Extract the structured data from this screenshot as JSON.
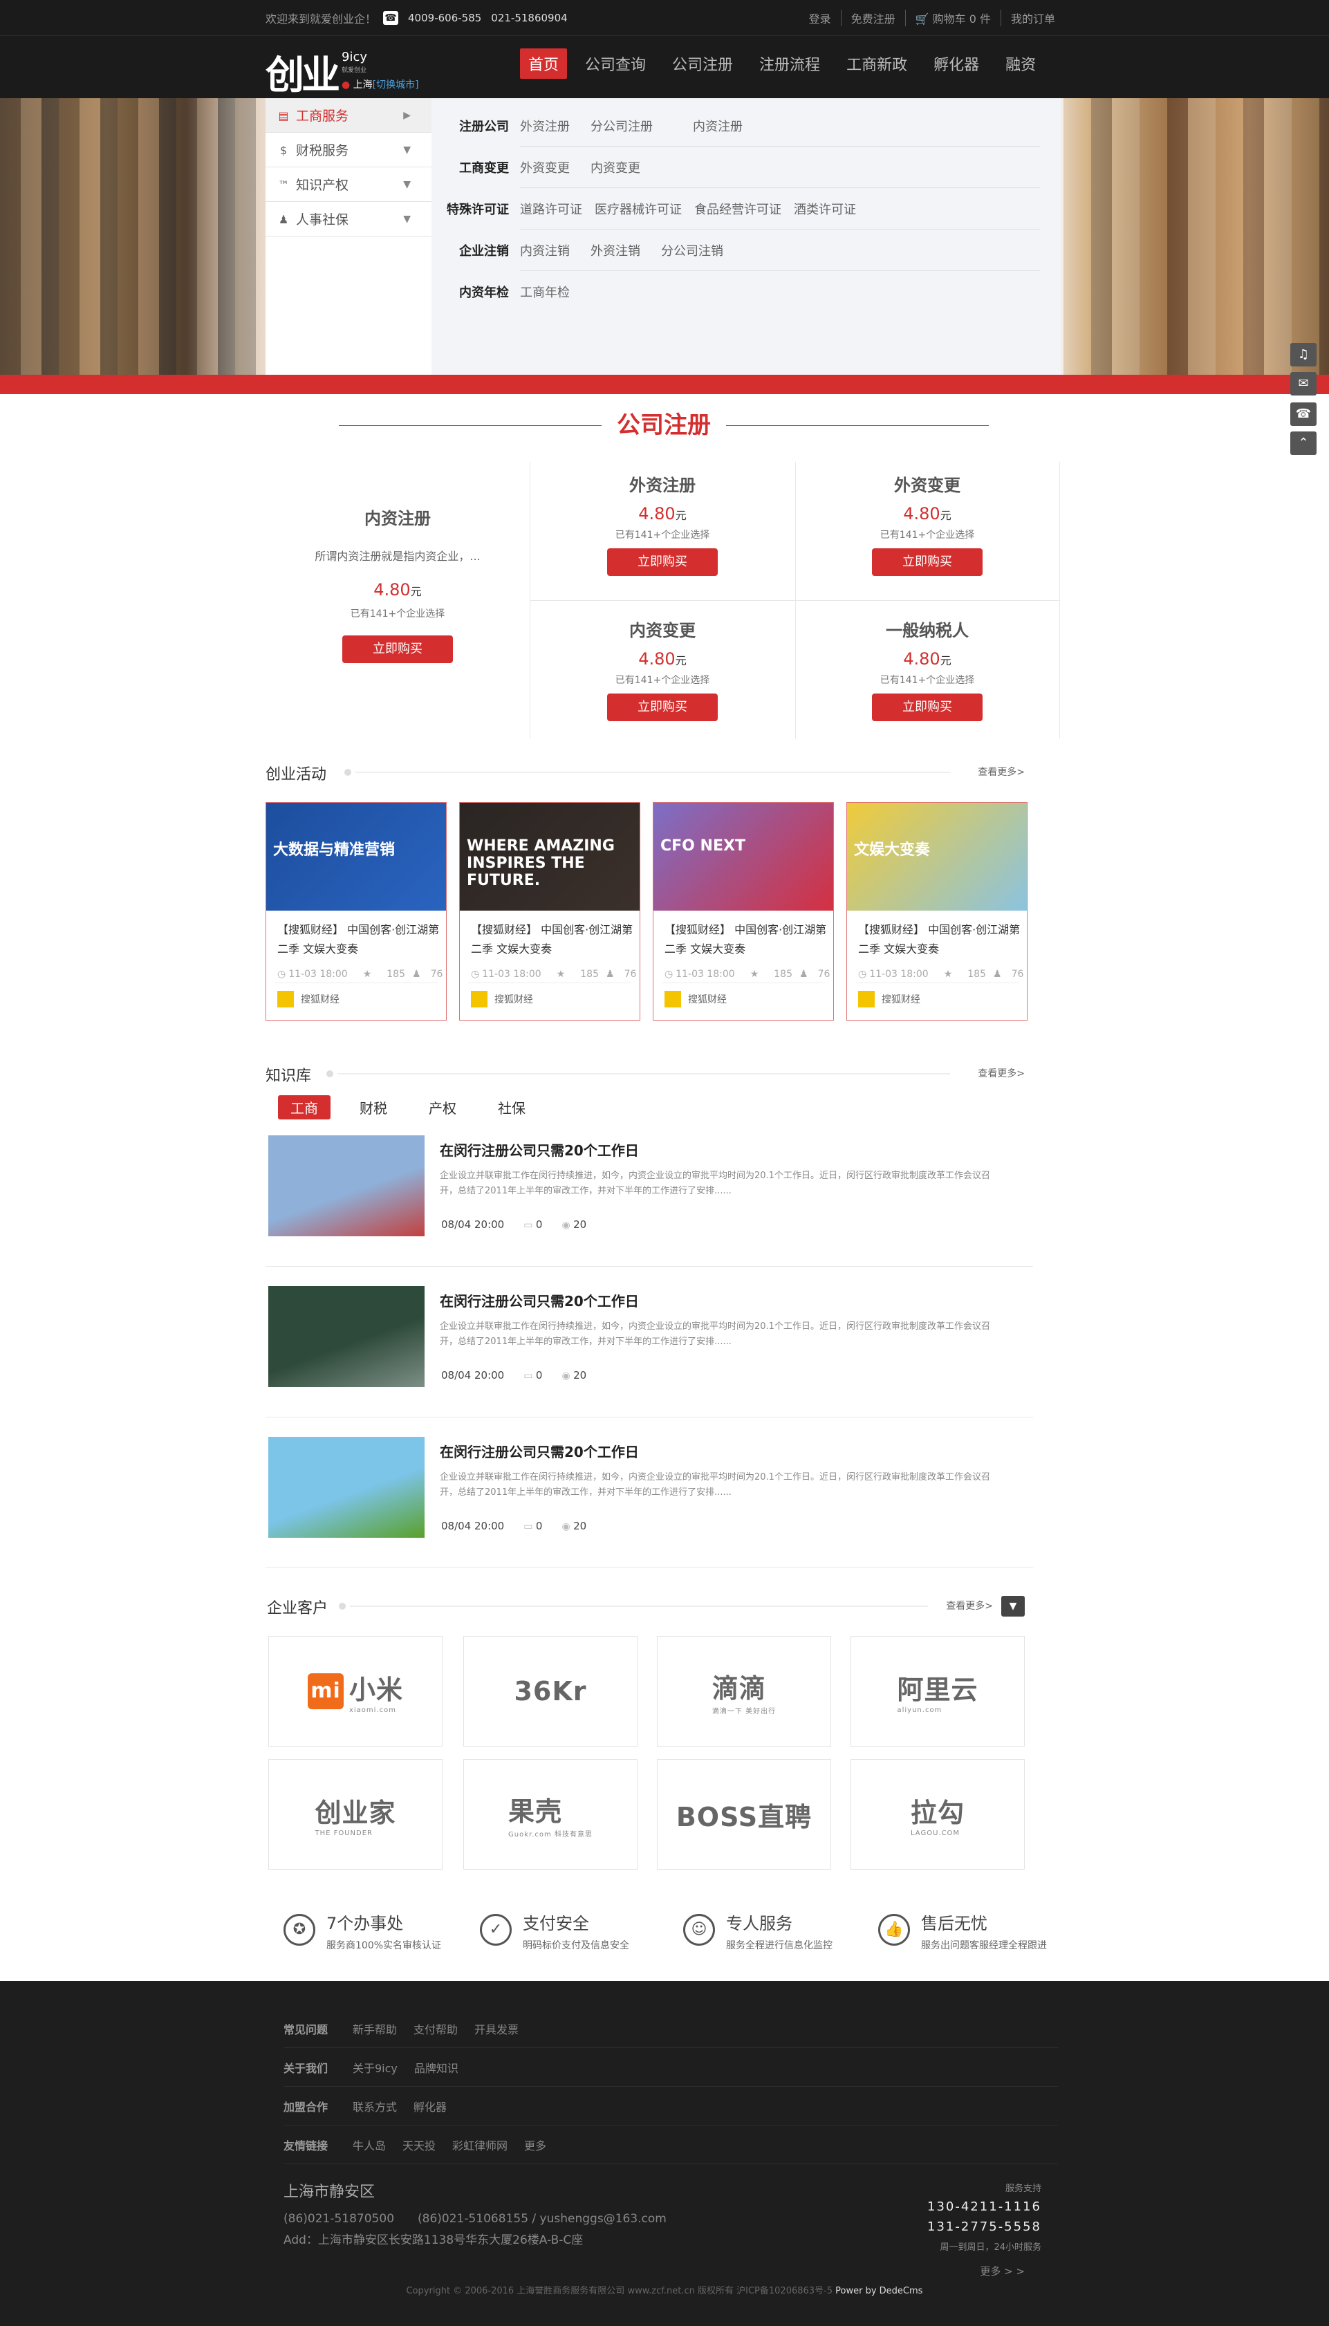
{
  "topbar": {
    "welcome": "欢迎来到就爱创业企！",
    "phone1": "4009-606-585",
    "phone2": "021-51860904",
    "login": "登录",
    "register": "免费注册",
    "cart": "购物车 0 件",
    "orders": "我的订单"
  },
  "header": {
    "logo_glyph": "创业",
    "brand": "9icy",
    "brand_sub": "就爱创业",
    "city": "上海",
    "switch_city": "[切换城市]",
    "nav": [
      "首页",
      "公司查询",
      "公司注册",
      "注册流程",
      "工商新政",
      "孵化器",
      "融资"
    ]
  },
  "sidemenu": [
    {
      "label": "工商服务",
      "icon": "briefcase-icon",
      "arrow": "▶"
    },
    {
      "label": "财税服务",
      "icon": "money-bag-icon",
      "arrow": "▼"
    },
    {
      "label": "知识产权",
      "icon": "trademark-icon",
      "arrow": "▼"
    },
    {
      "label": "人事社保",
      "icon": "person-icon",
      "arrow": "▼"
    }
  ],
  "submenu": [
    {
      "heading": "注册公司",
      "items": [
        "外资注册",
        "分公司注册",
        "内资注册"
      ]
    },
    {
      "heading": "工商变更",
      "items": [
        "外资变更",
        "内资变更"
      ]
    },
    {
      "heading": "特殊许可证",
      "items": [
        "道路许可证",
        "医疗器械许可证",
        "食品经营许可证",
        "酒类许可证"
      ]
    },
    {
      "heading": "企业注销",
      "items": [
        "内资注销",
        "外资注销",
        "分公司注销"
      ]
    },
    {
      "heading": "内资年检",
      "items": [
        "工商年检"
      ]
    }
  ],
  "section_title": "公司注册",
  "featured_product": {
    "name": "内资注册",
    "desc": "所谓内资注册就是指内资企业，...",
    "price": "4.80",
    "unit": "元",
    "sold": "已有141+个企业选择",
    "buy": "立即购买"
  },
  "products": [
    {
      "name": "外资注册",
      "price": "4.80",
      "unit": "元",
      "sold": "已有141+个企业选择",
      "buy": "立即购买"
    },
    {
      "name": "外资变更",
      "price": "4.80",
      "unit": "元",
      "sold": "已有141+个企业选择",
      "buy": "立即购买"
    },
    {
      "name": "内资变更",
      "price": "4.80",
      "unit": "元",
      "sold": "已有141+个企业选择",
      "buy": "立即购买"
    },
    {
      "name": "一般纳税人",
      "price": "4.80",
      "unit": "元",
      "sold": "已有141+个企业选择",
      "buy": "立即购买"
    }
  ],
  "activities": {
    "title": "创业活动",
    "more": "查看更多>",
    "items": [
      {
        "img_text": "大数据与精准营销",
        "title": "【搜狐财经】 中国创客·创江湖第二季 文娱大变奏",
        "date": "11-03 18:00",
        "views": "185",
        "people": "76",
        "source": "搜狐财经",
        "colors": [
          "#1d4e9e",
          "#2a64c0"
        ]
      },
      {
        "img_text": "WHERE AMAZING INSPIRES THE FUTURE.",
        "title": "【搜狐财经】 中国创客·创江湖第二季 文娱大变奏",
        "date": "11-03 18:00",
        "views": "185",
        "people": "76",
        "source": "搜狐财经",
        "colors": [
          "#2a2523",
          "#3b302b"
        ]
      },
      {
        "img_text": "CFO NEXT",
        "title": "【搜狐财经】 中国创客·创江湖第二季 文娱大变奏",
        "date": "11-03 18:00",
        "views": "185",
        "people": "76",
        "source": "搜狐财经",
        "colors": [
          "#7c6fc7",
          "#d43040"
        ]
      },
      {
        "img_text": "文娱大变奏",
        "title": "【搜狐财经】 中国创客·创江湖第二季 文娱大变奏",
        "date": "11-03 18:00",
        "views": "185",
        "people": "76",
        "source": "搜狐财经",
        "colors": [
          "#f0cb3a",
          "#8bc3e0"
        ]
      }
    ]
  },
  "knowledge": {
    "title": "知识库",
    "more": "查看更多>",
    "tabs": [
      "工商",
      "财税",
      "产权",
      "社保"
    ],
    "articles": [
      {
        "title": "在闵行注册公司只需20个工作日",
        "desc": "企业设立并联审批工作在闵行持续推进，如今，内资企业设立的审批平均时间为20.1个工作日。近日，闵行区行政审批制度改革工作会议召开，总结了2011年上半年的审改工作，并对下半年的工作进行了安排......",
        "date": "08/04 20:00",
        "comments": "0",
        "views": "20",
        "colors": [
          "#8fb0d8",
          "#c2403d"
        ]
      },
      {
        "title": "在闵行注册公司只需20个工作日",
        "desc": "企业设立并联审批工作在闵行持续推进，如今，内资企业设立的审批平均时间为20.1个工作日。近日，闵行区行政审批制度改革工作会议召开，总结了2011年上半年的审改工作，并对下半年的工作进行了安排......",
        "date": "08/04 20:00",
        "comments": "0",
        "views": "20",
        "colors": [
          "#2e4a3a",
          "#7d8f86"
        ]
      },
      {
        "title": "在闵行注册公司只需20个工作日",
        "desc": "企业设立并联审批工作在闵行持续推进，如今，内资企业设立的审批平均时间为20.1个工作日。近日，闵行区行政审批制度改革工作会议召开，总结了2011年上半年的审改工作，并对下半年的工作进行了安排......",
        "date": "08/04 20:00",
        "comments": "0",
        "views": "20",
        "colors": [
          "#7cc4e8",
          "#5aa02a"
        ]
      }
    ]
  },
  "clients": {
    "title": "企业客户",
    "more": "查看更多>",
    "logos": [
      {
        "name": "小米",
        "sub": "xiaomi.com"
      },
      {
        "name": "36Kr",
        "sub": ""
      },
      {
        "name": "滴滴",
        "sub": "滴滴一下 美好出行"
      },
      {
        "name": "阿里云",
        "sub": "aliyun.com"
      },
      {
        "name": "创业家",
        "sub": "THE FOUNDER"
      },
      {
        "name": "果壳",
        "sub": "Guokr.com 科技有意思"
      },
      {
        "name": "BOSS直聘",
        "sub": ""
      },
      {
        "name": "拉勾",
        "sub": "LAGOU.COM"
      }
    ]
  },
  "features": [
    {
      "title": "7个办事处",
      "sub": "服务商100%实名审核认证",
      "icon": "medal-icon"
    },
    {
      "title": "支付安全",
      "sub": "明码标价支付及信息安全",
      "icon": "shield-icon"
    },
    {
      "title": "专人服务",
      "sub": "服务全程进行信息化监控",
      "icon": "user-icon"
    },
    {
      "title": "售后无忧",
      "sub": "服务出问题客服经理全程跟进",
      "icon": "thumbs-up-icon"
    }
  ],
  "footer": {
    "rows": [
      {
        "heading": "常见问题",
        "links": [
          "新手帮助",
          "支付帮助",
          "开具发票"
        ]
      },
      {
        "heading": "关于我们",
        "links": [
          "关于9icy",
          "品牌知识"
        ]
      },
      {
        "heading": "加盟合作",
        "links": [
          "联系方式",
          "孵化器"
        ]
      },
      {
        "heading": "友情链接",
        "links": [
          "牛人岛",
          "天天投",
          "彩虹律师网",
          "更多"
        ]
      }
    ],
    "city": "上海市静安区",
    "phones": "(86)021-51870500　　(86)021-51068155 / yushenggs@163.com",
    "address": "Add：上海市静安区长安路1138号华东大厦26楼A-B-C座",
    "support_label": "服务支持",
    "support1": "130-4211-1116",
    "support2": "131-2775-5558",
    "support_hours": "周一到周日，24小时服务",
    "more": "更多 > >",
    "copyright": "Copyright © 2006-2016 上海誉胜商务服务有限公司 www.zcf.net.cn  版权所有  沪ICP备10206863号-5",
    "powered": "Power by DedeCms"
  },
  "float_tools": [
    {
      "icon": "qq-icon"
    },
    {
      "icon": "wechat-icon"
    },
    {
      "icon": "phone-icon"
    },
    {
      "icon": "back-to-top-icon"
    }
  ]
}
